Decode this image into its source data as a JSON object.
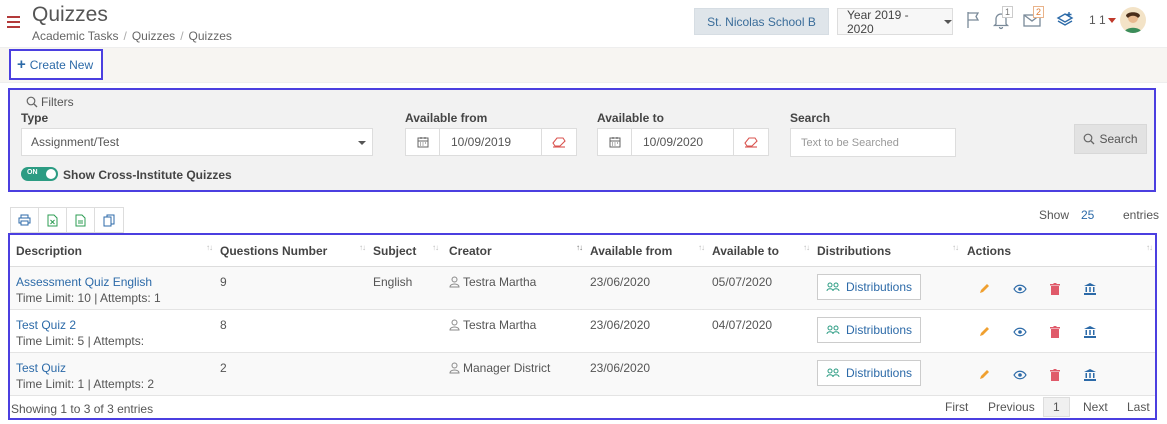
{
  "header": {
    "title": "Quizzes",
    "breadcrumb": [
      "Academic Tasks",
      "Quizzes",
      "Quizzes"
    ],
    "school": "St. Nicolas School B",
    "year": "Year 2019 - 2020",
    "notifications_count": "1",
    "messages_count": "2",
    "user_label": "1 1",
    "icons": [
      "menu-icon",
      "flag-icon",
      "bell-icon",
      "envelope-icon",
      "layers-icon",
      "avatar"
    ]
  },
  "toolbar": {
    "create_label": "Create New"
  },
  "filters": {
    "legend": "Filters",
    "type_label": "Type",
    "type_value": "Assignment/Test",
    "from_label": "Available from",
    "from_value": "10/09/2019",
    "to_label": "Available to",
    "to_value": "10/09/2020",
    "search_label": "Search",
    "search_placeholder": "Text to be Searched",
    "search_button": "Search",
    "toggle_on": "ON",
    "toggle_label": "Show Cross-Institute Quizzes"
  },
  "table_controls": {
    "show": "Show",
    "entries_count": "25",
    "entries": "entries"
  },
  "table": {
    "columns": [
      "Description",
      "Questions Number",
      "Subject",
      "Creator",
      "Available from",
      "Available to",
      "Distributions",
      "Actions"
    ],
    "rows": [
      {
        "title": "Assessment Quiz English",
        "meta": "Time Limit:  10 | Attempts:  1",
        "questions": "9",
        "subject": "English",
        "creator": "Testra Martha",
        "from": "23/06/2020",
        "to": "05/07/2020",
        "dist": "Distributions"
      },
      {
        "title": "Test Quiz 2",
        "meta": "Time Limit:  5 | Attempts:",
        "questions": "8",
        "subject": "",
        "creator": "Testra Martha",
        "from": "23/06/2020",
        "to": "04/07/2020",
        "dist": "Distributions"
      },
      {
        "title": "Test Quiz",
        "meta": "Time Limit:  1 | Attempts:  2",
        "questions": "2",
        "subject": "",
        "creator": "Manager District",
        "from": "23/06/2020",
        "to": "",
        "dist": "Distributions"
      }
    ],
    "info": "Showing 1 to 3 of 3 entries",
    "pager": {
      "first": "First",
      "previous": "Previous",
      "current": "1",
      "next": "Next",
      "last": "Last"
    }
  },
  "colors": {
    "accent": "#2c6aa8",
    "highlight_border": "#4b3fe0",
    "toggle": "#2c9c83",
    "delete": "#e05a6a",
    "edit": "#f0a030"
  }
}
